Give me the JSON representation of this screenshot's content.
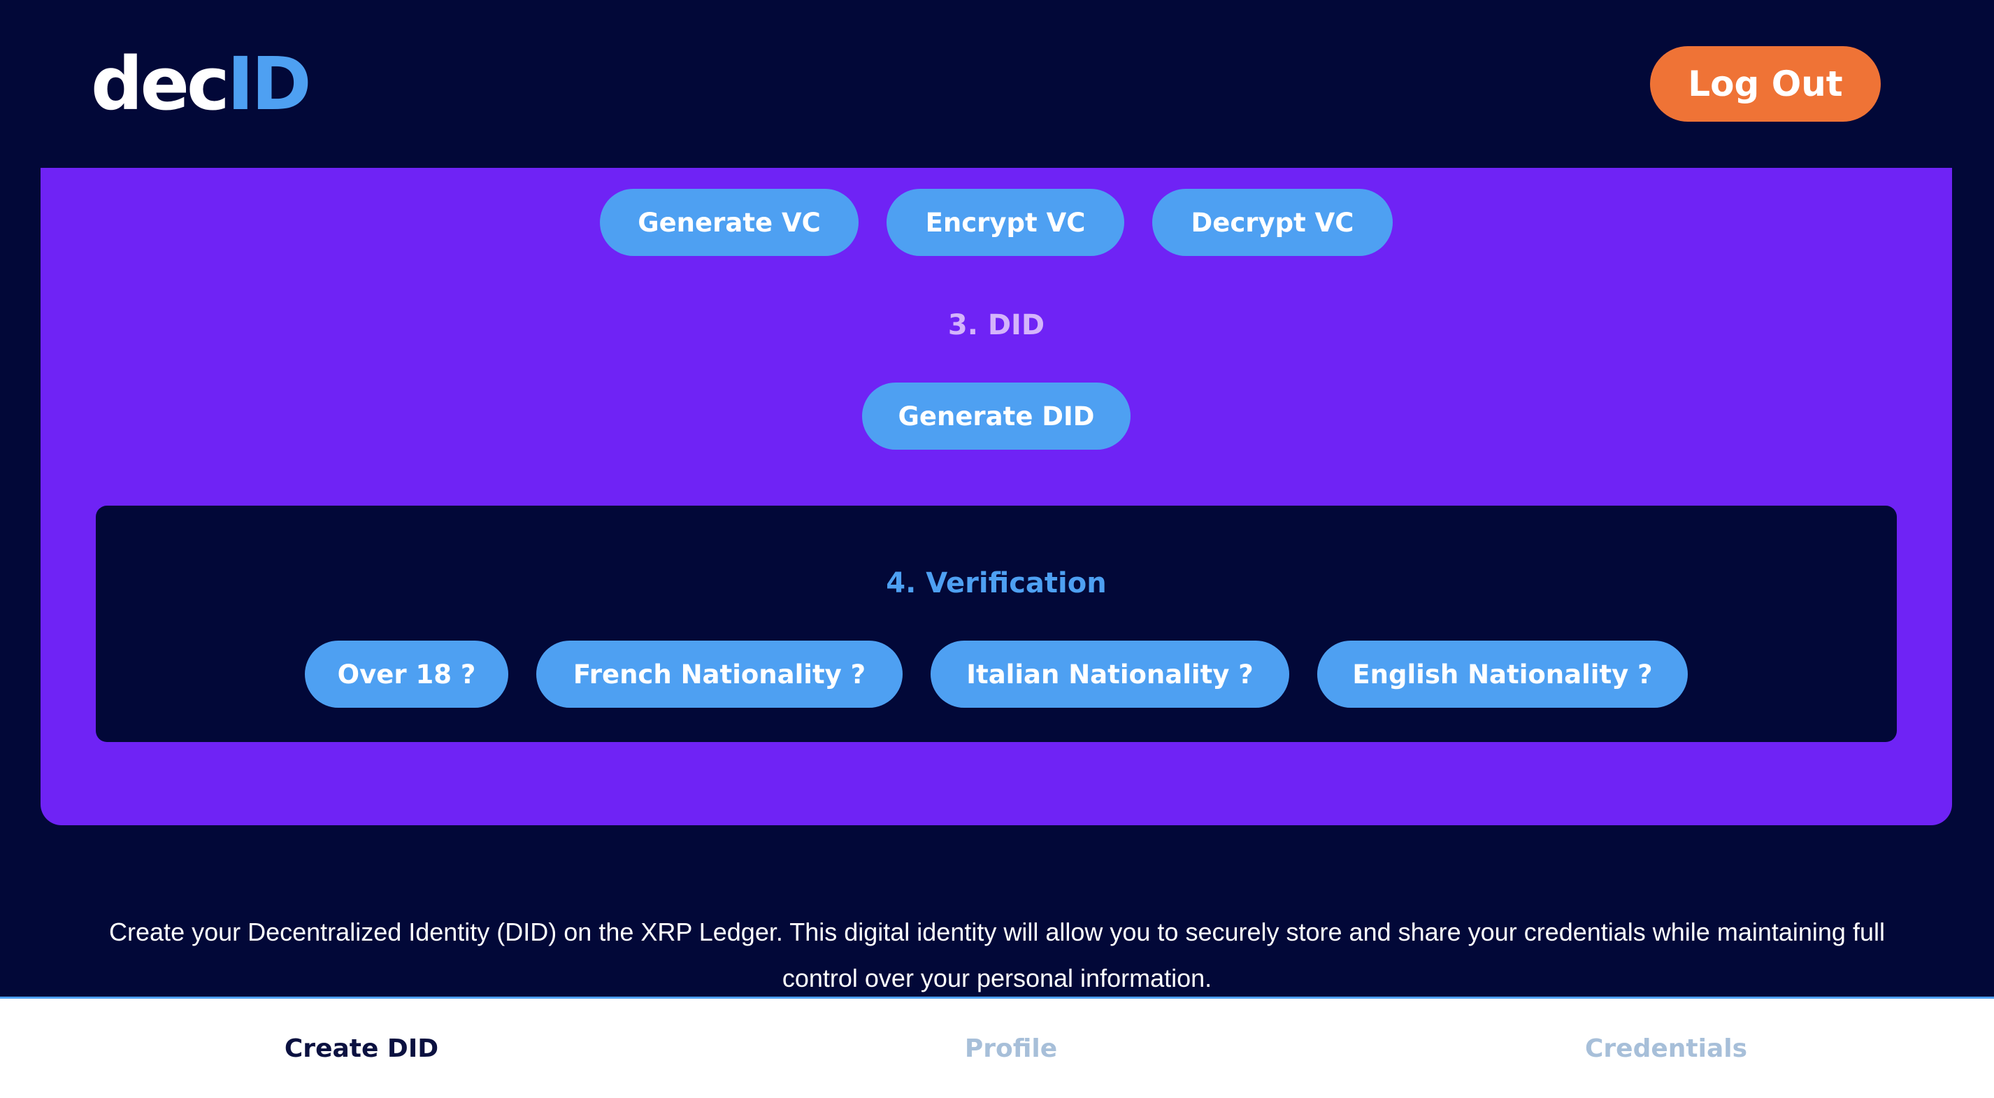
{
  "header": {
    "logo_part1": "dec",
    "logo_part2": "ID",
    "logout_label": "Log Out"
  },
  "vc_actions": {
    "generate_vc": "Generate VC",
    "encrypt_vc": "Encrypt VC",
    "decrypt_vc": "Decrypt VC"
  },
  "did_section": {
    "title": "3. DID",
    "generate_did": "Generate DID"
  },
  "verification": {
    "title": "4. Verification",
    "over_18": "Over 18 ?",
    "french": "French Nationality ?",
    "italian": "Italian Nationality ?",
    "english": "English Nationality ?"
  },
  "description": "Create your Decentralized Identity (DID) on the XRP Ledger. This digital identity will allow you to securely store and share your credentials while maintaining full control over your personal information.",
  "bottom_nav": {
    "create_did": "Create DID",
    "profile": "Profile",
    "credentials": "Credentials",
    "active_tab": "Create DID"
  },
  "colors": {
    "background": "#020838",
    "panel": "#6f23f5",
    "accent_blue": "#4ea0f2",
    "logout_orange": "#ef7336",
    "did_title": "#d4b4fb",
    "nav_inactive": "#a7bfd9"
  }
}
